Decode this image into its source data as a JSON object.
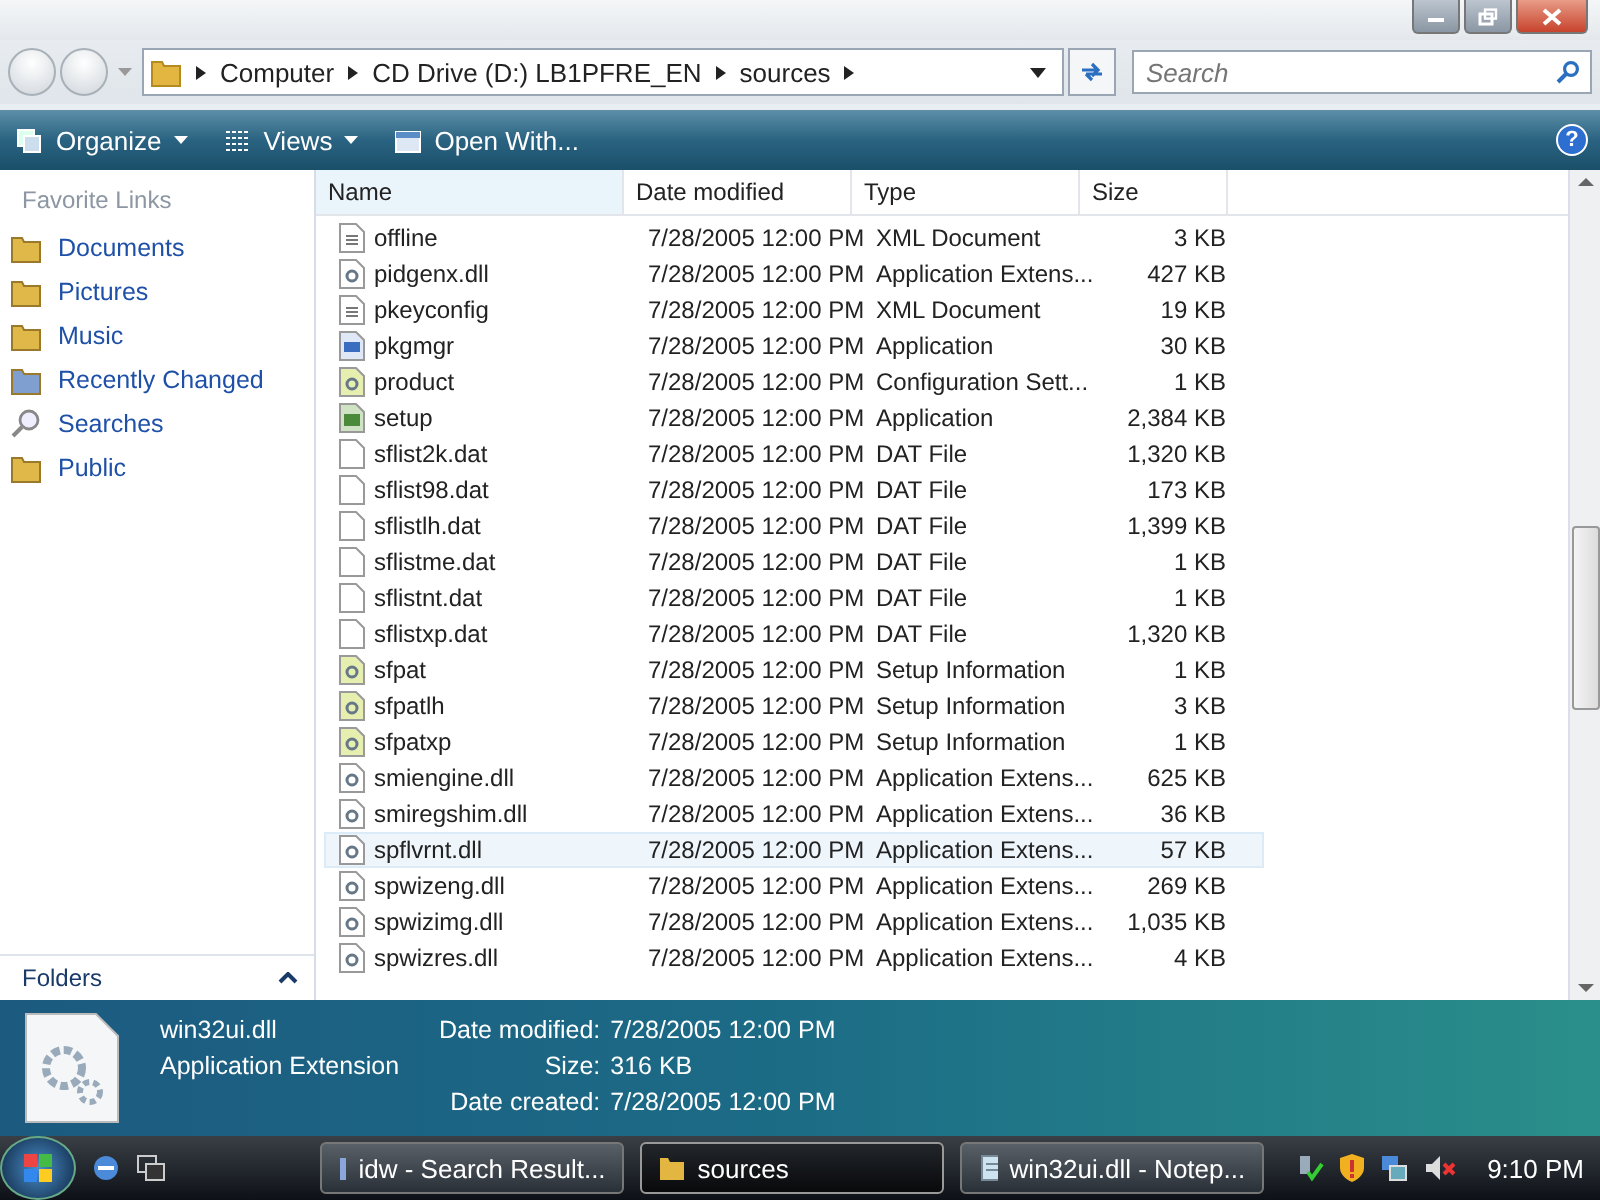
{
  "address_bar": {
    "crumbs": [
      "Computer",
      "CD Drive (D:) LB1PFRE_EN",
      "sources"
    ]
  },
  "search": {
    "placeholder": "Search"
  },
  "toolbar": [
    "Organize",
    "Views",
    "Open With..."
  ],
  "help": "?",
  "sidebar": {
    "heading": "Favorite Links",
    "items": [
      {
        "label": "Documents",
        "kind": "documents"
      },
      {
        "label": "Pictures",
        "kind": "pictures"
      },
      {
        "label": "Music",
        "kind": "music"
      },
      {
        "label": "Recently Changed",
        "kind": "recent"
      },
      {
        "label": "Searches",
        "kind": "search"
      },
      {
        "label": "Public",
        "kind": "public"
      }
    ],
    "folders": "Folders"
  },
  "table": {
    "columns": [
      "Name",
      "Date modified",
      "Type",
      "Size"
    ],
    "rows": [
      {
        "kind": "xml",
        "hovered": false,
        "cells": [
          "offline",
          "7/28/2005 12:00 PM",
          "XML Document",
          "3 KB"
        ]
      },
      {
        "kind": "dll",
        "hovered": false,
        "cells": [
          "pidgenx.dll",
          "7/28/2005 12:00 PM",
          "Application Extens...",
          "427 KB"
        ]
      },
      {
        "kind": "xml",
        "hovered": false,
        "cells": [
          "pkeyconfig",
          "7/28/2005 12:00 PM",
          "XML Document",
          "19 KB"
        ]
      },
      {
        "kind": "app",
        "hovered": false,
        "cells": [
          "pkgmgr",
          "7/28/2005 12:00 PM",
          "Application",
          "30 KB"
        ]
      },
      {
        "kind": "config",
        "hovered": false,
        "cells": [
          "product",
          "7/28/2005 12:00 PM",
          "Configuration Sett...",
          "1 KB"
        ]
      },
      {
        "kind": "setup",
        "hovered": false,
        "cells": [
          "setup",
          "7/28/2005 12:00 PM",
          "Application",
          "2,384 KB"
        ]
      },
      {
        "kind": "dat",
        "hovered": false,
        "cells": [
          "sflist2k.dat",
          "7/28/2005 12:00 PM",
          "DAT File",
          "1,320 KB"
        ]
      },
      {
        "kind": "dat",
        "hovered": false,
        "cells": [
          "sflist98.dat",
          "7/28/2005 12:00 PM",
          "DAT File",
          "173 KB"
        ]
      },
      {
        "kind": "dat",
        "hovered": false,
        "cells": [
          "sflistlh.dat",
          "7/28/2005 12:00 PM",
          "DAT File",
          "1,399 KB"
        ]
      },
      {
        "kind": "dat",
        "hovered": false,
        "cells": [
          "sflistme.dat",
          "7/28/2005 12:00 PM",
          "DAT File",
          "1 KB"
        ]
      },
      {
        "kind": "dat",
        "hovered": false,
        "cells": [
          "sflistnt.dat",
          "7/28/2005 12:00 PM",
          "DAT File",
          "1 KB"
        ]
      },
      {
        "kind": "dat",
        "hovered": false,
        "cells": [
          "sflistxp.dat",
          "7/28/2005 12:00 PM",
          "DAT File",
          "1,320 KB"
        ]
      },
      {
        "kind": "config",
        "hovered": false,
        "cells": [
          "sfpat",
          "7/28/2005 12:00 PM",
          "Setup Information",
          "1 KB"
        ]
      },
      {
        "kind": "config",
        "hovered": false,
        "cells": [
          "sfpatlh",
          "7/28/2005 12:00 PM",
          "Setup Information",
          "3 KB"
        ]
      },
      {
        "kind": "config",
        "hovered": false,
        "cells": [
          "sfpatxp",
          "7/28/2005 12:00 PM",
          "Setup Information",
          "1 KB"
        ]
      },
      {
        "kind": "dll",
        "hovered": false,
        "cells": [
          "smiengine.dll",
          "7/28/2005 12:00 PM",
          "Application Extens...",
          "625 KB"
        ]
      },
      {
        "kind": "dll",
        "hovered": false,
        "cells": [
          "smiregshim.dll",
          "7/28/2005 12:00 PM",
          "Application Extens...",
          "36 KB"
        ]
      },
      {
        "kind": "dll",
        "hovered": true,
        "cells": [
          "spflvrnt.dll",
          "7/28/2005 12:00 PM",
          "Application Extens...",
          "57 KB"
        ]
      },
      {
        "kind": "dll",
        "hovered": false,
        "cells": [
          "spwizeng.dll",
          "7/28/2005 12:00 PM",
          "Application Extens...",
          "269 KB"
        ]
      },
      {
        "kind": "dll",
        "hovered": false,
        "cells": [
          "spwizimg.dll",
          "7/28/2005 12:00 PM",
          "Application Extens...",
          "1,035 KB"
        ]
      },
      {
        "kind": "dll",
        "hovered": false,
        "cells": [
          "spwizres.dll",
          "7/28/2005 12:00 PM",
          "Application Extens...",
          "4 KB"
        ]
      }
    ]
  },
  "details": {
    "name": "win32ui.dll",
    "type": "Application Extension",
    "fields": [
      {
        "label": "Date modified:",
        "value": "7/28/2005 12:00 PM"
      },
      {
        "label": "Size:",
        "value": "316 KB"
      },
      {
        "label": "Date created:",
        "value": "7/28/2005 12:00 PM"
      }
    ]
  },
  "taskbar": {
    "tasks": [
      {
        "label": "idw - Search Result...",
        "kind": "search",
        "selected": false
      },
      {
        "label": "sources",
        "kind": "folder",
        "selected": true
      },
      {
        "label": "win32ui.dll - Notep...",
        "kind": "notepad",
        "selected": false
      }
    ],
    "clock": "9:10 PM"
  }
}
